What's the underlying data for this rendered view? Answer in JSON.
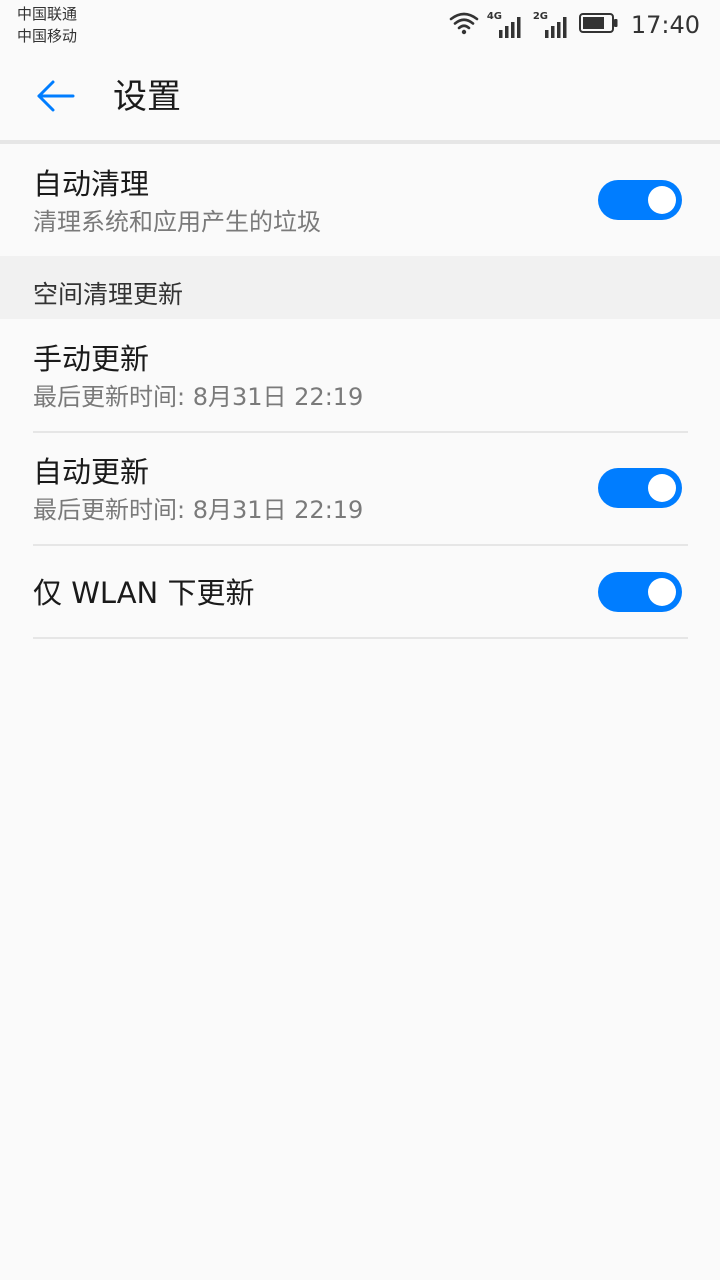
{
  "status_bar": {
    "carrier1": "中国联通",
    "carrier2": "中国移动",
    "network1": "4G",
    "network2": "2G",
    "time": "17:40"
  },
  "app_bar": {
    "title": "设置"
  },
  "settings": {
    "auto_clean": {
      "title": "自动清理",
      "subtitle": "清理系统和应用产生的垃圾",
      "enabled": true
    },
    "section_header": "空间清理更新",
    "manual_update": {
      "title": "手动更新",
      "subtitle": "最后更新时间: 8月31日 22:19"
    },
    "auto_update": {
      "title": "自动更新",
      "subtitle": "最后更新时间: 8月31日 22:19",
      "enabled": true
    },
    "wlan_only": {
      "title": "仅 WLAN 下更新",
      "enabled": true
    }
  },
  "colors": {
    "accent": "#007dff",
    "background": "#fafafa",
    "section_background": "#f1f1f1",
    "secondary_text": "#7a7a7a"
  }
}
